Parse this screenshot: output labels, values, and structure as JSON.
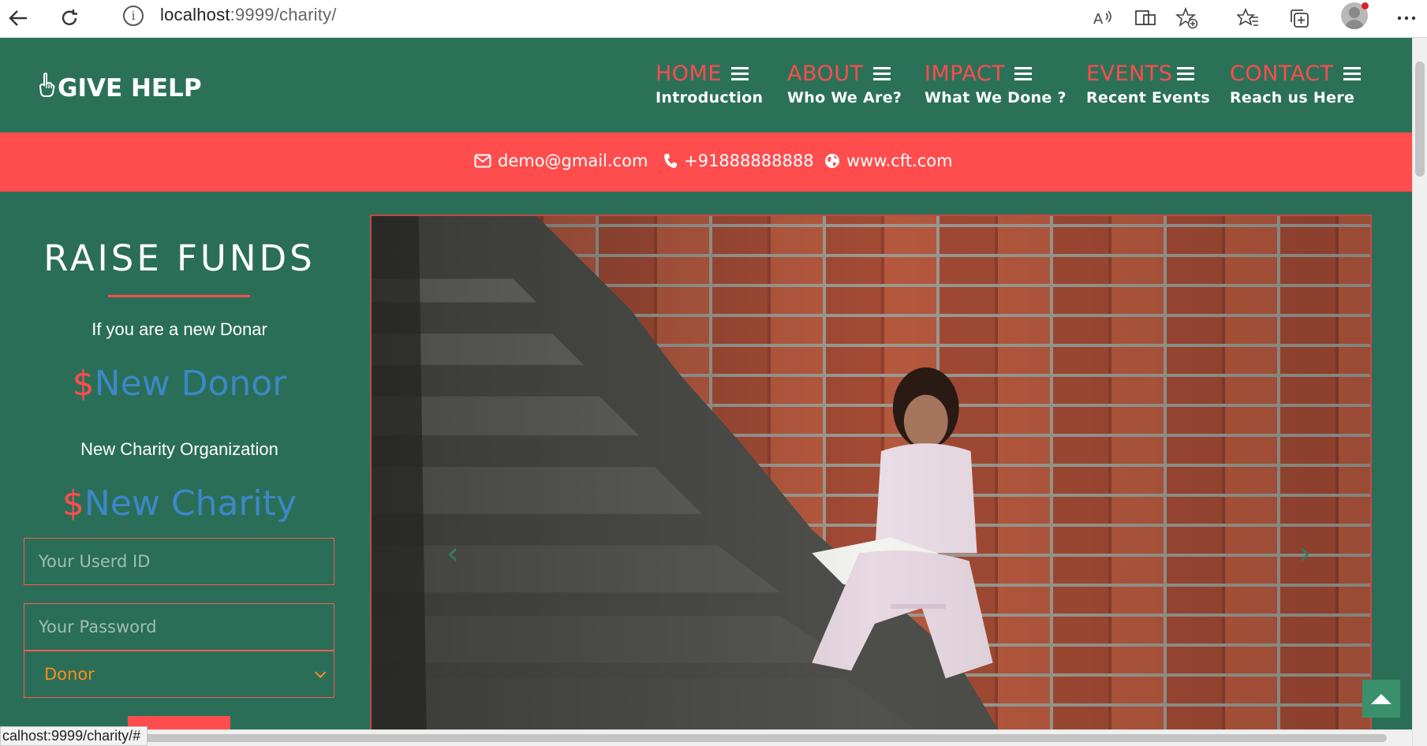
{
  "browser": {
    "url_host": "localhost",
    "url_rest": ":9999/charity/",
    "status_url": "calhost:9999/charity/#"
  },
  "header": {
    "logo_text": "GIVE HELP",
    "nav": [
      {
        "label": "HOME",
        "sub": "Introduction"
      },
      {
        "label": "ABOUT",
        "sub": "Who We Are?"
      },
      {
        "label": "IMPACT",
        "sub": "What We Done ?"
      },
      {
        "label": "EVENTS",
        "sub": "Recent Events"
      },
      {
        "label": "CONTACT",
        "sub": "Reach us Here"
      }
    ]
  },
  "contact": {
    "email": "demo@gmail.com",
    "phone": "+91888888888",
    "website": "www.cft.com"
  },
  "panel": {
    "title": "RAISE FUNDS",
    "donor_prompt": "If you are a new Donar",
    "donor_link_symbol": "$",
    "donor_link": "New Donor",
    "charity_prompt": "New Charity Organization",
    "charity_link_symbol": "$",
    "charity_link": "New Charity",
    "userid_placeholder": "Your Userd ID",
    "password_placeholder": "Your Password",
    "role_selected": "Donor"
  },
  "colors": {
    "brand_green": "#2b7158",
    "accent_red": "#ff4d4d",
    "link_blue": "#3d87c8",
    "select_orange": "#ff8c1a"
  }
}
